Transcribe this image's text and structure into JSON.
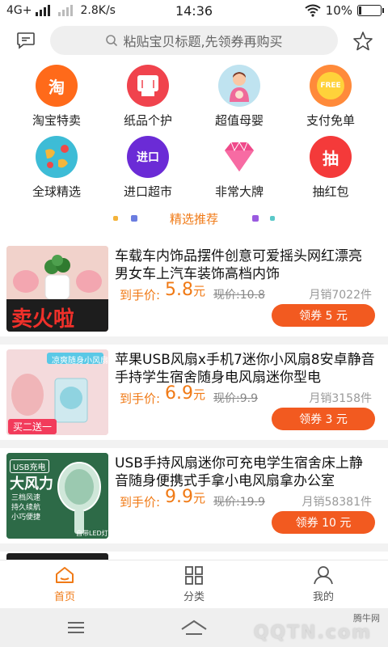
{
  "status_bar": {
    "network": "4G+",
    "speed": "2.8K/s",
    "time": "14:36",
    "battery": "10%",
    "battery_level": 0.1
  },
  "search": {
    "placeholder": "粘贴宝贝标题,先领券再购买"
  },
  "categories": [
    {
      "label": "淘宝特卖",
      "icon": "taobao-icon",
      "glyph": "淘",
      "color": "#ff6a1a"
    },
    {
      "label": "纸品个护",
      "icon": "tissue-icon",
      "glyph": "",
      "color": "#f0434d"
    },
    {
      "label": "超值母婴",
      "icon": "mother-baby-icon",
      "glyph": "",
      "color": "#bfe3f0"
    },
    {
      "label": "支付免单",
      "icon": "free-icon",
      "glyph": "FREE",
      "color": "#ff8a3a"
    },
    {
      "label": "全球精选",
      "icon": "globe-icon",
      "glyph": "",
      "color": "#3dbcd6"
    },
    {
      "label": "进口超市",
      "icon": "import-icon",
      "glyph": "进口",
      "color": "#6b2bd6"
    },
    {
      "label": "非常大牌",
      "icon": "diamond-icon",
      "glyph": "",
      "color": "#ffffff"
    },
    {
      "label": "抽红包",
      "icon": "red-packet-icon",
      "glyph": "抽",
      "color": "#f43a3a"
    }
  ],
  "section_title": "精选推荐",
  "products": [
    {
      "title": "车载车内饰品摆件创意可爱摇头网红漂亮男女车上汽车装饰高档内饰",
      "price_label": "到手价:",
      "price": "5.8",
      "price_unit": "元",
      "original": "现价:10.8",
      "sales": "月销7022件",
      "coupon": "领券 5 元",
      "image_text": "卖火啦"
    },
    {
      "title": "苹果USB风扇x手机7迷你小风扇8安卓静音手持学生宿舍随身电风扇迷你型电",
      "price_label": "到手价:",
      "price": "6.9",
      "price_unit": "元",
      "original": "现价:9.9",
      "sales": "月销3158件",
      "coupon": "领券 3 元",
      "image_text": "凉爽随身小风扇",
      "image_text2": "买二送一"
    },
    {
      "title": "USB手持风扇迷你可充电学生宿舍床上静音随身便携式手拿小电风扇拿办公室",
      "price_label": "到手价:",
      "price": "9.9",
      "price_unit": "元",
      "original": "现价:19.9",
      "sales": "月销58381件",
      "coupon": "领券 10 元",
      "image_text": "大风力",
      "image_badge": "USB充电",
      "image_lines": [
        "三档风速",
        "持久续航",
        "小巧便捷"
      ],
      "image_bottom": "自带LED灯"
    }
  ],
  "bottom_nav": {
    "home": "首页",
    "category": "分类",
    "mine": "我的"
  },
  "watermark": {
    "site": "腾牛网",
    "logo": "QQTN.com"
  },
  "colors": {
    "accent": "#f07a16",
    "coupon": "#f25a20"
  }
}
